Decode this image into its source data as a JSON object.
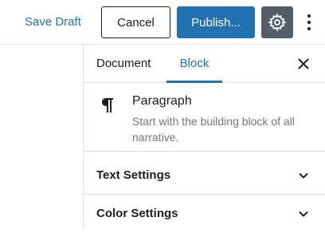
{
  "header": {
    "save_draft": "Save Draft",
    "cancel": "Cancel",
    "publish": "Publish...",
    "settings_icon": "gear-icon",
    "more_icon": "vertical-ellipsis-icon"
  },
  "sidebar": {
    "tabs": [
      {
        "label": "Document",
        "active": false
      },
      {
        "label": "Block",
        "active": true
      }
    ],
    "close_icon": "close-icon",
    "block": {
      "icon": "pilcrow-icon",
      "title": "Paragraph",
      "description": "Start with the building block of all narrative."
    },
    "panels": [
      {
        "title": "Text Settings",
        "icon": "chevron-down-icon"
      },
      {
        "title": "Color Settings",
        "icon": "chevron-down-icon"
      }
    ]
  },
  "colors": {
    "accent": "#2271b1",
    "settings_bg": "#555d66",
    "border": "#e0e0e0",
    "muted_text": "#757575"
  }
}
